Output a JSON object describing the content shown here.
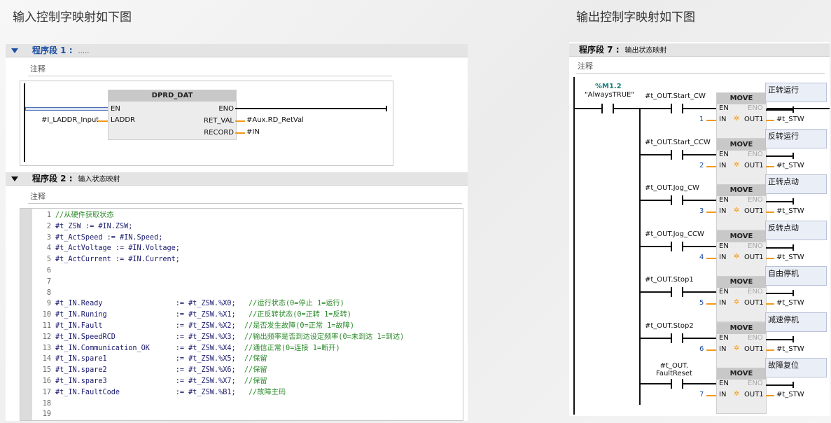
{
  "captions": {
    "input": "输入控制字映射如下图",
    "output": "输出控制字映射如下图"
  },
  "left": {
    "net1": {
      "title": "程序段 1 :",
      "subtitle": "....."
    },
    "net1_comment": "注释",
    "fb": {
      "name": "DPRD_DAT",
      "en": "EN",
      "eno": "ENO",
      "laddr": "LADDR",
      "ret_val": "RET_VAL",
      "record": "RECORD",
      "laddr_param": "#I_LADDR_Input",
      "ret_val_param": "#Aux.RD_RetVal",
      "record_param": "#IN"
    },
    "net2": {
      "title": "程序段 2 :",
      "subtitle": "输入状态映射"
    },
    "net2_comment": "注释",
    "code_lines": [
      {
        "n": "1",
        "code": "",
        "comment": "//从硬件获取状态"
      },
      {
        "n": "2",
        "code": "#t_ZSW := #IN.ZSW;",
        "comment": ""
      },
      {
        "n": "3",
        "code": "#t_ActSpeed := #IN.Speed;",
        "comment": ""
      },
      {
        "n": "4",
        "code": "#t_ActVoltage := #IN.Voltage;",
        "comment": ""
      },
      {
        "n": "5",
        "code": "#t_ActCurrent := #IN.Current;",
        "comment": ""
      },
      {
        "n": "6",
        "code": "",
        "comment": ""
      },
      {
        "n": "7",
        "code": "",
        "comment": ""
      },
      {
        "n": "8",
        "code": "",
        "comment": ""
      },
      {
        "n": "9",
        "code": "#t_IN.Ready                 := #t_ZSW.%X0;   ",
        "comment": "//运行状态(0=停止 1=运行)"
      },
      {
        "n": "10",
        "code": "#t_IN.Runing                := #t_ZSW.%X1;   ",
        "comment": "//正反转状态(0=正转 1=反转)"
      },
      {
        "n": "11",
        "code": "#t_IN.Fault                 := #t_ZSW.%X2;  ",
        "comment": "//是否发生故障(0=正常 1=故障)"
      },
      {
        "n": "12",
        "code": "#t_IN.SpeedRCD              := #t_ZSW.%X3;  ",
        "comment": "//输出频率是否到达设定频率(0=未到达 1=到达)"
      },
      {
        "n": "13",
        "code": "#t_IN.Communication_OK      := #t_ZSW.%X4;  ",
        "comment": "//通信正常(0=连接 1=断开)"
      },
      {
        "n": "14",
        "code": "#t_IN.spare1                := #t_ZSW.%X5;  ",
        "comment": "//保留"
      },
      {
        "n": "15",
        "code": "#t_IN.spare2                := #t_ZSW.%X6;  ",
        "comment": "//保留"
      },
      {
        "n": "16",
        "code": "#t_IN.spare3                := #t_ZSW.%X7;  ",
        "comment": "//保留"
      },
      {
        "n": "17",
        "code": "#t_IN.FaultCode             := #t_ZSW.%B1;   ",
        "comment": "//故障主码"
      },
      {
        "n": "18",
        "code": "",
        "comment": ""
      },
      {
        "n": "19",
        "code": "",
        "comment": ""
      }
    ]
  },
  "right": {
    "net7": {
      "title": "程序段 7 :",
      "subtitle": "输出状态映射"
    },
    "comment": "注释",
    "always": {
      "addr": "%M1.2",
      "name": "\"AlwaysTRUE\""
    },
    "move": {
      "title": "MOVE",
      "en": "EN",
      "eno": "ENO",
      "in": "IN",
      "out": "OUT1"
    },
    "rungs": [
      {
        "contact": "#t_OUT.Start_CW",
        "value": "1",
        "dest": "#t_STW",
        "note": "正转运行"
      },
      {
        "contact": "#t_OUT.Start_CCW",
        "value": "2",
        "dest": "#t_STW",
        "note": "反转运行"
      },
      {
        "contact": "#t_OUT.Jog_CW",
        "value": "3",
        "dest": "#t_STW",
        "note": "正转点动"
      },
      {
        "contact": "#t_OUT.Jog_CCW",
        "value": "4",
        "dest": "#t_STW",
        "note": "反转点动"
      },
      {
        "contact": "#t_OUT.Stop1",
        "value": "5",
        "dest": "#t_STW",
        "note": "自由停机"
      },
      {
        "contact": "#t_OUT.Stop2",
        "value": "6",
        "dest": "#t_STW",
        "note": "减速停机"
      },
      {
        "contact": "#t_OUT.\nFaultReset",
        "value": "7",
        "dest": "#t_STW",
        "note": "故障复位"
      }
    ]
  },
  "colors": {
    "accent": "#1c4fa3",
    "wire_orange": "#f29a1a",
    "comment_green": "#2a8a2a"
  }
}
